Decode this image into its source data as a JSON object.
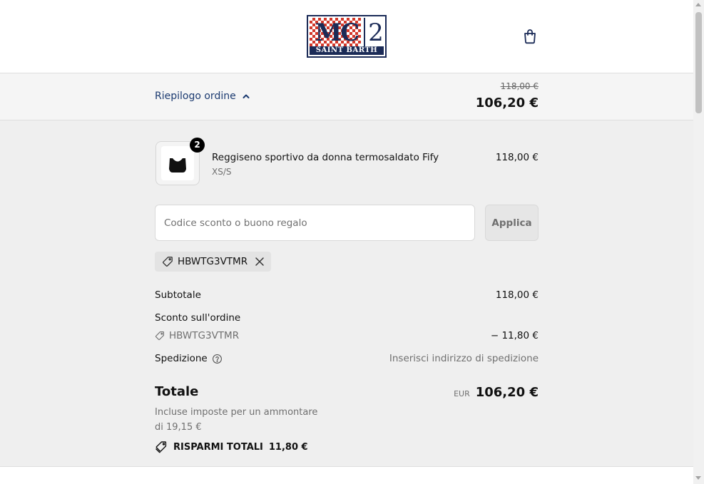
{
  "header": {
    "logo": {
      "mark": "MC",
      "number": "2",
      "tagline": "SAINT BARTH"
    },
    "cart_icon": "shopping-bag-icon"
  },
  "summary": {
    "toggle_label": "Riepilogo ordine",
    "toggle_icon": "chevron-up-icon",
    "original_price": "118,00 €",
    "total_price": "106,20 €"
  },
  "product": {
    "name": "Reggiseno sportivo da donna termosaldato Fify",
    "variant": "XS/S",
    "price": "118,00 €",
    "quantity": "2"
  },
  "discount": {
    "placeholder": "Codice sconto o buono regalo",
    "value": "",
    "apply_label": "Applica",
    "applied_code": "HBWTG3VTMR"
  },
  "lines": {
    "subtotal_label": "Subtotale",
    "subtotal_value": "118,00 €",
    "order_discount_label": "Sconto sull'ordine",
    "discount_code": "HBWTG3VTMR",
    "discount_value": "− 11,80 €",
    "shipping_label": "Spedizione",
    "shipping_value": "Inserisci indirizzo di spedizione"
  },
  "total": {
    "label": "Totale",
    "currency": "EUR",
    "value": "106,20 €",
    "tax_note": "Incluse imposte per un ammontare di 19,15 €",
    "savings_label": "RISPARMI TOTALI",
    "savings_value": "11,80 €"
  },
  "colors": {
    "accent_link": "#1b3a70",
    "logo_navy": "#1b2b57",
    "logo_red": "#d3382a",
    "panel_bg": "#efefef"
  }
}
